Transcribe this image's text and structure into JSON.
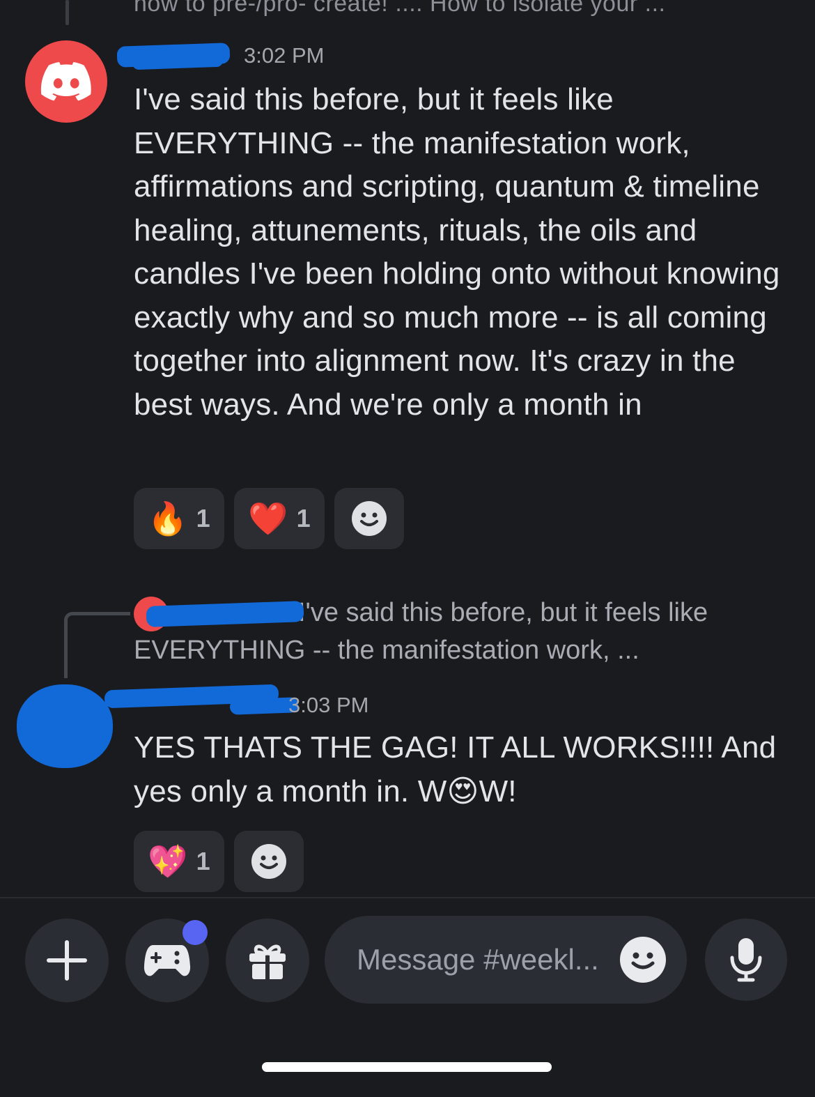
{
  "colors": {
    "background": "#1a1b1f",
    "accent": "#5865f2",
    "discord_red": "#ee4a4b",
    "redaction_blue": "#1269d8"
  },
  "thread": {
    "top_preview": "how to pre-/pro- create!  .... How to isolate your ..."
  },
  "messages": [
    {
      "avatar_icon": "discord-logo-icon",
      "time": "3:02 PM",
      "text": "I've said this before, but it feels like EVERYTHING -- the manifestation work, affirmations and scripting, quantum & timeline healing, attunements, rituals, the oils and candles I've been holding onto without knowing exactly why and so much more -- is all coming together into alignment now. It's crazy in the best ways. And we're only a month in",
      "reactions": [
        {
          "emoji": "🔥",
          "count": "1"
        },
        {
          "emoji": "❤️",
          "count": "1"
        }
      ]
    },
    {
      "reply_preview": "I've said this before, but it feels like EVERYTHING -- the manifestation work, ...",
      "reply_preview_line1": "I've said this before, but it feels like",
      "reply_preview_line2": "EVERYTHING -- the manifestation work, ...",
      "time": "3:03 PM",
      "text_line1": "YES THATS THE GAG! IT ALL WORKS!!!!  And",
      "text_line2_a": "yes only a month in. W",
      "text_line2_emoji": "😍",
      "text_line2_b": "W!",
      "reactions": [
        {
          "emoji": "💖",
          "count": "1"
        }
      ]
    }
  ],
  "composer": {
    "placeholder": "Message #weekl...",
    "icons": [
      "plus-icon",
      "gamepad-icon",
      "gift-icon",
      "emoji-icon",
      "microphone-icon"
    ]
  }
}
